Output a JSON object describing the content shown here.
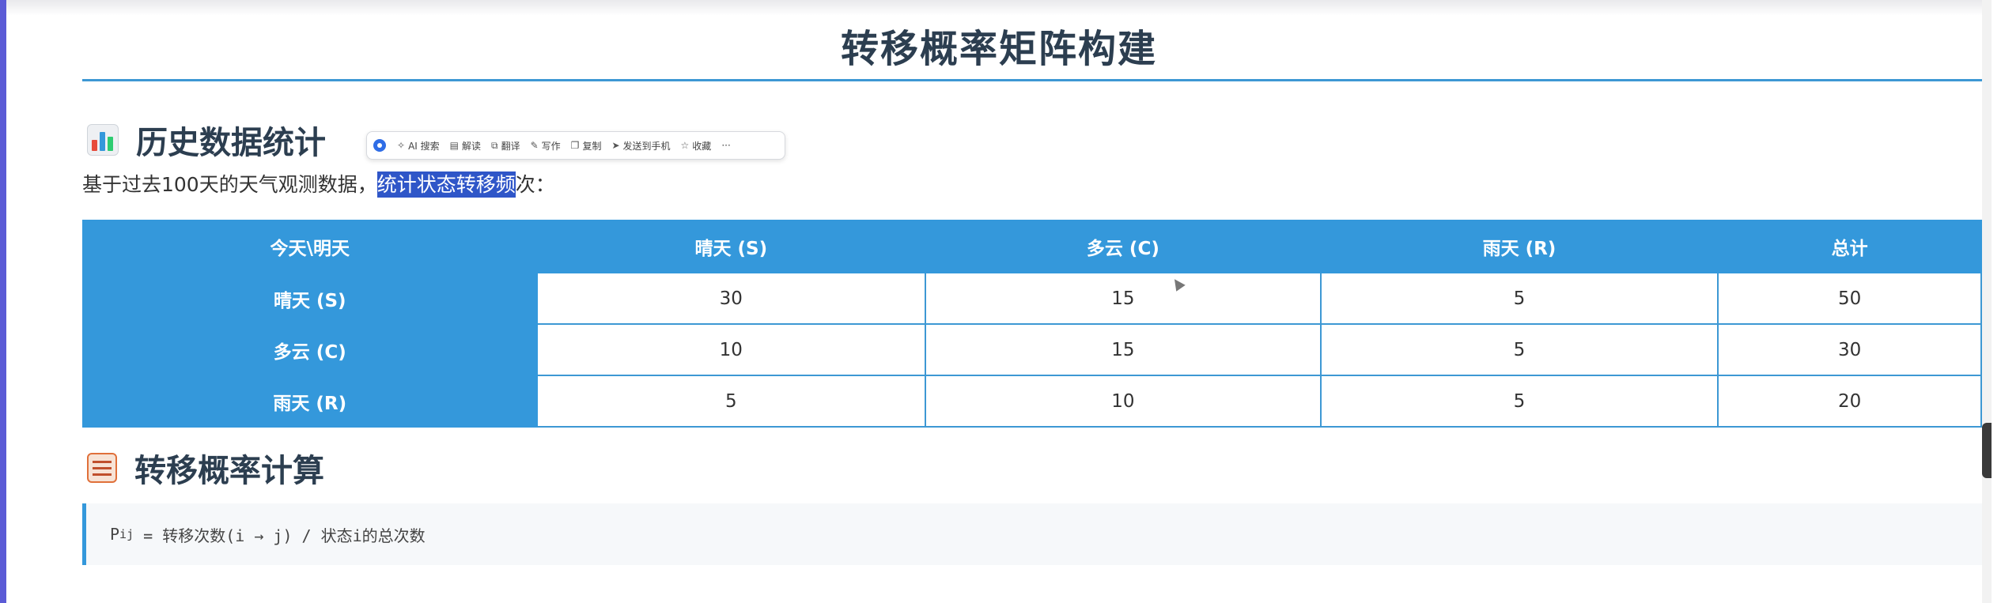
{
  "page": {
    "title": "转移概率矩阵构建"
  },
  "section1": {
    "heading": "历史数据统计",
    "icon": "bar-chart-icon",
    "intro_before": "基于过去100天的天气观测数据，",
    "intro_highlight": "统计状态转移频",
    "intro_after": "次："
  },
  "toolbar": {
    "items": [
      {
        "icon": "sparkle-icon",
        "label": "AI 搜索"
      },
      {
        "icon": "read-icon",
        "label": "解读"
      },
      {
        "icon": "translate-icon",
        "label": "翻译"
      },
      {
        "icon": "pen-icon",
        "label": "写作"
      },
      {
        "icon": "copy-icon",
        "label": "复制"
      },
      {
        "icon": "send-icon",
        "label": "发送到手机"
      },
      {
        "icon": "star-icon",
        "label": "收藏"
      },
      {
        "icon": "more-icon",
        "label": "···"
      }
    ]
  },
  "table": {
    "headers": [
      "今天\\明天",
      "晴天 (S)",
      "多云 (C)",
      "雨天 (R)",
      "总计"
    ],
    "rows": [
      {
        "label": "晴天 (S)",
        "cells": [
          "30",
          "15",
          "5",
          "50"
        ]
      },
      {
        "label": "多云 (C)",
        "cells": [
          "10",
          "15",
          "5",
          "30"
        ]
      },
      {
        "label": "雨天 (R)",
        "cells": [
          "5",
          "10",
          "5",
          "20"
        ]
      }
    ]
  },
  "section2": {
    "heading": "转移概率计算",
    "icon": "abacus-icon"
  },
  "formula": {
    "p": "P",
    "sub": "ij",
    "rest": " = 转移次数(i → j) / 状态i的总次数"
  },
  "colors": {
    "accent": "#3498db",
    "title": "#2c3e50",
    "highlight": "#2f56c8"
  }
}
